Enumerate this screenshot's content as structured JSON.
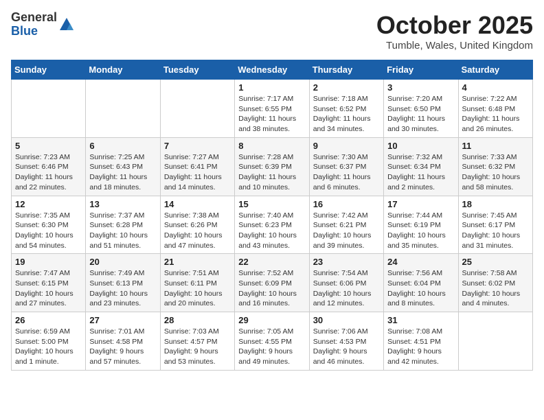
{
  "header": {
    "logo_general": "General",
    "logo_blue": "Blue",
    "month_title": "October 2025",
    "subtitle": "Tumble, Wales, United Kingdom"
  },
  "days_of_week": [
    "Sunday",
    "Monday",
    "Tuesday",
    "Wednesday",
    "Thursday",
    "Friday",
    "Saturday"
  ],
  "weeks": [
    [
      {
        "day": "",
        "info": ""
      },
      {
        "day": "",
        "info": ""
      },
      {
        "day": "",
        "info": ""
      },
      {
        "day": "1",
        "info": "Sunrise: 7:17 AM\nSunset: 6:55 PM\nDaylight: 11 hours\nand 38 minutes."
      },
      {
        "day": "2",
        "info": "Sunrise: 7:18 AM\nSunset: 6:52 PM\nDaylight: 11 hours\nand 34 minutes."
      },
      {
        "day": "3",
        "info": "Sunrise: 7:20 AM\nSunset: 6:50 PM\nDaylight: 11 hours\nand 30 minutes."
      },
      {
        "day": "4",
        "info": "Sunrise: 7:22 AM\nSunset: 6:48 PM\nDaylight: 11 hours\nand 26 minutes."
      }
    ],
    [
      {
        "day": "5",
        "info": "Sunrise: 7:23 AM\nSunset: 6:46 PM\nDaylight: 11 hours\nand 22 minutes."
      },
      {
        "day": "6",
        "info": "Sunrise: 7:25 AM\nSunset: 6:43 PM\nDaylight: 11 hours\nand 18 minutes."
      },
      {
        "day": "7",
        "info": "Sunrise: 7:27 AM\nSunset: 6:41 PM\nDaylight: 11 hours\nand 14 minutes."
      },
      {
        "day": "8",
        "info": "Sunrise: 7:28 AM\nSunset: 6:39 PM\nDaylight: 11 hours\nand 10 minutes."
      },
      {
        "day": "9",
        "info": "Sunrise: 7:30 AM\nSunset: 6:37 PM\nDaylight: 11 hours\nand 6 minutes."
      },
      {
        "day": "10",
        "info": "Sunrise: 7:32 AM\nSunset: 6:34 PM\nDaylight: 11 hours\nand 2 minutes."
      },
      {
        "day": "11",
        "info": "Sunrise: 7:33 AM\nSunset: 6:32 PM\nDaylight: 10 hours\nand 58 minutes."
      }
    ],
    [
      {
        "day": "12",
        "info": "Sunrise: 7:35 AM\nSunset: 6:30 PM\nDaylight: 10 hours\nand 54 minutes."
      },
      {
        "day": "13",
        "info": "Sunrise: 7:37 AM\nSunset: 6:28 PM\nDaylight: 10 hours\nand 51 minutes."
      },
      {
        "day": "14",
        "info": "Sunrise: 7:38 AM\nSunset: 6:26 PM\nDaylight: 10 hours\nand 47 minutes."
      },
      {
        "day": "15",
        "info": "Sunrise: 7:40 AM\nSunset: 6:23 PM\nDaylight: 10 hours\nand 43 minutes."
      },
      {
        "day": "16",
        "info": "Sunrise: 7:42 AM\nSunset: 6:21 PM\nDaylight: 10 hours\nand 39 minutes."
      },
      {
        "day": "17",
        "info": "Sunrise: 7:44 AM\nSunset: 6:19 PM\nDaylight: 10 hours\nand 35 minutes."
      },
      {
        "day": "18",
        "info": "Sunrise: 7:45 AM\nSunset: 6:17 PM\nDaylight: 10 hours\nand 31 minutes."
      }
    ],
    [
      {
        "day": "19",
        "info": "Sunrise: 7:47 AM\nSunset: 6:15 PM\nDaylight: 10 hours\nand 27 minutes."
      },
      {
        "day": "20",
        "info": "Sunrise: 7:49 AM\nSunset: 6:13 PM\nDaylight: 10 hours\nand 23 minutes."
      },
      {
        "day": "21",
        "info": "Sunrise: 7:51 AM\nSunset: 6:11 PM\nDaylight: 10 hours\nand 20 minutes."
      },
      {
        "day": "22",
        "info": "Sunrise: 7:52 AM\nSunset: 6:09 PM\nDaylight: 10 hours\nand 16 minutes."
      },
      {
        "day": "23",
        "info": "Sunrise: 7:54 AM\nSunset: 6:06 PM\nDaylight: 10 hours\nand 12 minutes."
      },
      {
        "day": "24",
        "info": "Sunrise: 7:56 AM\nSunset: 6:04 PM\nDaylight: 10 hours\nand 8 minutes."
      },
      {
        "day": "25",
        "info": "Sunrise: 7:58 AM\nSunset: 6:02 PM\nDaylight: 10 hours\nand 4 minutes."
      }
    ],
    [
      {
        "day": "26",
        "info": "Sunrise: 6:59 AM\nSunset: 5:00 PM\nDaylight: 10 hours\nand 1 minute."
      },
      {
        "day": "27",
        "info": "Sunrise: 7:01 AM\nSunset: 4:58 PM\nDaylight: 9 hours\nand 57 minutes."
      },
      {
        "day": "28",
        "info": "Sunrise: 7:03 AM\nSunset: 4:57 PM\nDaylight: 9 hours\nand 53 minutes."
      },
      {
        "day": "29",
        "info": "Sunrise: 7:05 AM\nSunset: 4:55 PM\nDaylight: 9 hours\nand 49 minutes."
      },
      {
        "day": "30",
        "info": "Sunrise: 7:06 AM\nSunset: 4:53 PM\nDaylight: 9 hours\nand 46 minutes."
      },
      {
        "day": "31",
        "info": "Sunrise: 7:08 AM\nSunset: 4:51 PM\nDaylight: 9 hours\nand 42 minutes."
      },
      {
        "day": "",
        "info": ""
      }
    ]
  ]
}
